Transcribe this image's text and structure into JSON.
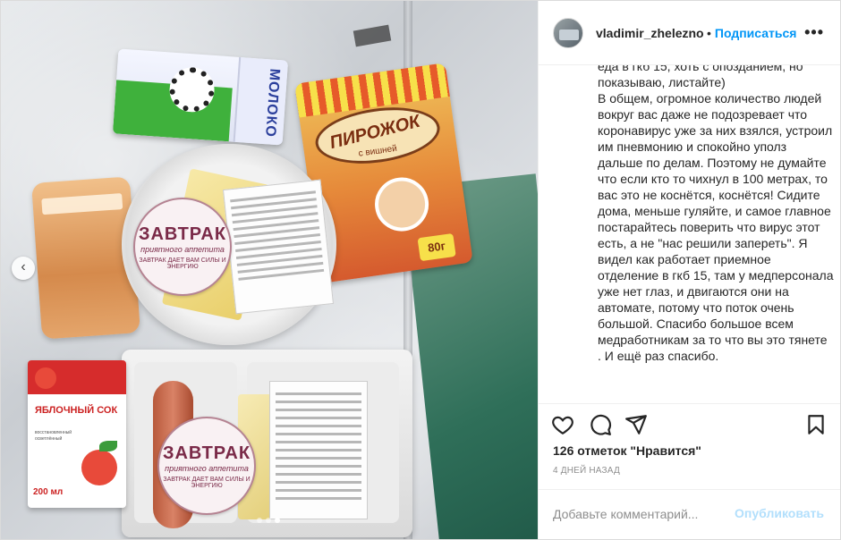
{
  "post": {
    "photo": {
      "milk_label": "МОЛОКО",
      "pie_label": "ПИРОЖОК",
      "pie_sub": "с вишней",
      "pie_price": "80г",
      "sticker_title": "ЗАВТРАК",
      "sticker_sub": "приятного аппетита",
      "sticker_ring": "ЗАВТРАК ДАЕТ ВАМ СИЛЫ И ЭНЕРГИЮ",
      "juice_name": "ЯБЛОЧНЫЙ СОК",
      "juice_sub": "восстановленный осветлённый",
      "juice_volume": "200 мл",
      "prev_icon": "chevron-left-icon",
      "carousel_total": 3,
      "carousel_active": 3
    },
    "header": {
      "username": "vladimir_zhelezno",
      "separator": "•",
      "follow_label": "Подписаться",
      "more_label": "•••"
    },
    "caption": "еда в гкб 15, хоть с опозданием, но показываю, листайте)\nВ общем, огромное количество людей вокруг вас даже не подозревает что коронавирус уже за них взялся, устроил им пневмонию и спокойно уполз дальше по делам. Поэтому не думайте что если кто то чихнул в 100 метрах, то вас это не коснётся, коснётся! Сидите дома, меньше гуляйте, и самое главное постарайтесь поверить что вирус этот есть, а не \"нас решили запереть\". Я видел как работает приемное отделение в гкб 15, там у медперсонала уже нет глаз, и двигаются они на автомате, потому что поток очень большой. Спасибо большое всем медработникам за то что вы это тянете . И ещё раз спасибо.",
    "actions": {
      "like_icon": "heart-icon",
      "comment_icon": "comment-icon",
      "share_icon": "paper-plane-icon",
      "save_icon": "bookmark-icon"
    },
    "likes": "126 отметок \"Нравится\"",
    "date": "4 ДНЕЙ НАЗАД",
    "comment": {
      "placeholder": "Добавьте комментарий...",
      "value": "",
      "publish_label": "Опубликовать"
    }
  }
}
